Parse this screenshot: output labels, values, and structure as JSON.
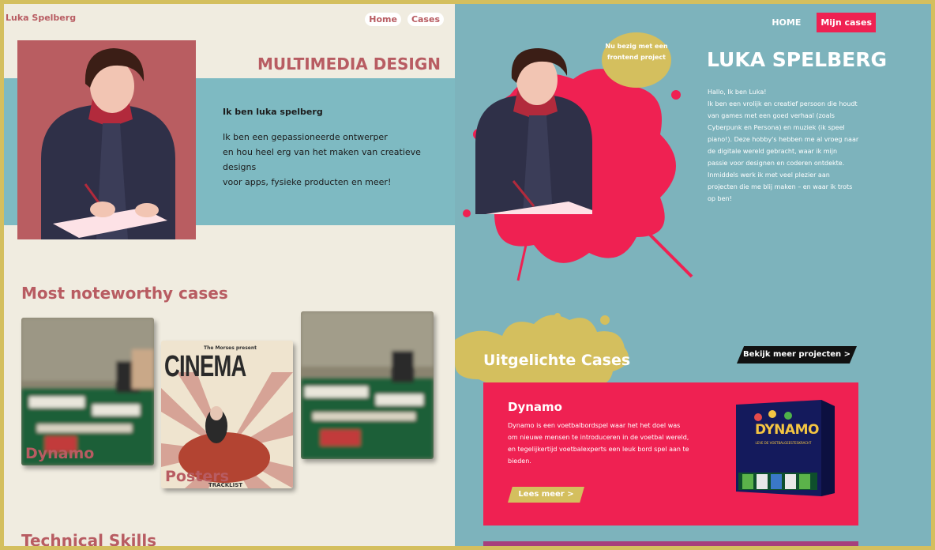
{
  "left_page": {
    "brand": "Luka Spelberg",
    "nav": {
      "home": "Home",
      "cases": "Cases"
    },
    "headline": "MULTIMEDIA DESIGN",
    "about": {
      "title": "Ik ben luka spelberg",
      "line1": "Ik ben een gepassioneerde ontwerper",
      "line2": "en hou heel erg van het maken van creatieve designs",
      "line3": "voor apps, fysieke producten en meer!"
    },
    "cases_title": "Most noteworthy cases",
    "cases": [
      {
        "label": "Dynamo"
      },
      {
        "label": "Posters",
        "poster_top": "The Morses present",
        "poster_title": "CINEMA",
        "poster_bottom": "TRACKLIST"
      },
      {
        "label": ""
      }
    ],
    "skills_title": "Technical Skills"
  },
  "right_page": {
    "nav": {
      "home": "HOME",
      "cases": "Mijn cases"
    },
    "badge": {
      "line1": "Nu bezig met een",
      "line2": "frontend project"
    },
    "title": "LUKA SPELBERG",
    "intro": "Hallo, Ik ben Luka!\nIk ben een vrolijk en creatief persoon die houdt van games met een goed verhaal (zoals Cyberpunk en Persona) en muziek (ik speel piano!). Deze hobby's hebben me al vroeg naar de digitale wereld gebracht, waar ik mijn passie voor designen en coderen ontdekte. Inmiddels werk ik met veel plezier aan projecten die me blij maken – en waar ik trots op ben!",
    "featured_title": "Uitgelichte Cases",
    "more_button": "Bekijk meer projecten >",
    "case": {
      "title": "Dynamo",
      "description": "Dynamo is een voetbalbordspel waar het het doel was om nieuwe mensen te introduceren in de voetbal wereld, en tegelijkertijd voetbalexperts een leuk bord spel aan te bieden.",
      "button": "Lees meer  >",
      "box_title": "DYNAMO",
      "box_subtitle": "LEVE DE VOETBALGEESTESKRACHT"
    }
  },
  "colors": {
    "rose": "#b85c62",
    "cream": "#f0ece0",
    "teal_left": "#7ebac2",
    "teal_right": "#7db3bc",
    "mustard": "#d4bf5e",
    "pink": "#ef2152"
  }
}
